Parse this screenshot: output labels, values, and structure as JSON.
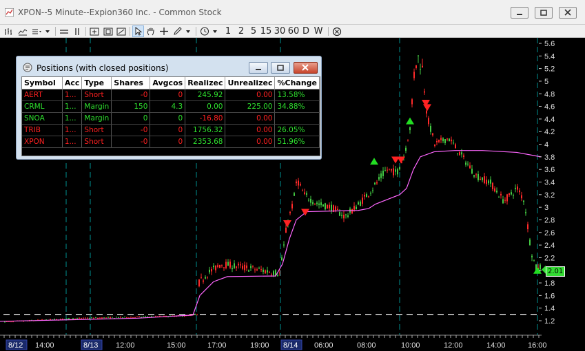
{
  "window": {
    "title": "XPON--5 Minute--Expion360 Inc. - Common Stock"
  },
  "toolbar": {
    "intervals": [
      "1",
      "2",
      "5",
      "15",
      "30",
      "60",
      "D",
      "W"
    ]
  },
  "positions": {
    "title": "Positions (with closed positions)",
    "columns": [
      "Symbol",
      "Acc",
      "Type",
      "Shares",
      "Avgcos",
      "Realizec",
      "Unrealizec",
      "%Change"
    ],
    "rows": [
      {
        "symbol": "AERT",
        "account": "1...",
        "type": "Short",
        "shares": "-0",
        "avgcost": "0",
        "realized": "245.92",
        "unrealized": "0.00",
        "pct": "13.58%",
        "symbol_color": "red",
        "pl_color": "green"
      },
      {
        "symbol": "CRML",
        "account": "1...",
        "type": "Margin",
        "shares": "150",
        "avgcost": "4.3",
        "realized": "0.00",
        "unrealized": "225.00",
        "pct": "34.88%",
        "symbol_color": "green",
        "pl_color": "green"
      },
      {
        "symbol": "SNOA",
        "account": "1...",
        "type": "Margin",
        "shares": "0",
        "avgcost": "0",
        "realized": "-16.80",
        "unrealized": "0.00",
        "pct": "",
        "symbol_color": "green",
        "pl_color": "red"
      },
      {
        "symbol": "TRIB",
        "account": "1...",
        "type": "Short",
        "shares": "-0",
        "avgcost": "0",
        "realized": "1756.32",
        "unrealized": "0.00",
        "pct": "26.05%",
        "symbol_color": "red",
        "pl_color": "green"
      },
      {
        "symbol": "XPON",
        "account": "1...",
        "type": "Short",
        "shares": "-0",
        "avgcost": "0",
        "realized": "2353.68",
        "unrealized": "0.00",
        "pct": "51.96%",
        "symbol_color": "red",
        "pl_color": "green"
      }
    ]
  },
  "chart_data": {
    "type": "candlestick",
    "symbol": "XPON",
    "interval": "5 Minute",
    "y_ticks": [
      "5.6",
      "5.4",
      "5.2",
      "5",
      "4.8",
      "4.6",
      "4.4",
      "4.2",
      "4",
      "3.8",
      "3.6",
      "3.4",
      "3.2",
      "3",
      "2.8",
      "2.6",
      "2.4",
      "2.2",
      "2",
      "1.8",
      "1.6",
      "1.4",
      "1.2"
    ],
    "ylim": [
      1.12,
      5.62
    ],
    "x_labels": [
      "8/12",
      "14:00",
      "8/13",
      "12:00",
      "15:00",
      "17:00",
      "19:00",
      "8/14",
      "06:00",
      "08:00",
      "10:00",
      "12:00",
      "14:00",
      "16:00"
    ],
    "date_labels": [
      "8/12",
      "8/13",
      "8/14"
    ],
    "last_price": "2.01",
    "reference_line": 1.3,
    "price_path": [
      [
        0,
        1.18
      ],
      [
        40,
        1.2
      ],
      [
        80,
        1.22
      ],
      [
        120,
        1.24
      ],
      [
        160,
        1.25
      ],
      [
        200,
        1.26
      ],
      [
        240,
        1.27
      ],
      [
        270,
        1.28
      ],
      [
        285,
        1.3
      ],
      [
        288,
        1.8
      ],
      [
        300,
        1.95
      ],
      [
        320,
        2.1
      ],
      [
        350,
        2.05
      ],
      [
        380,
        2.0
      ],
      [
        405,
        1.95
      ],
      [
        410,
        2.3
      ],
      [
        415,
        2.7
      ],
      [
        425,
        3.1
      ],
      [
        430,
        3.45
      ],
      [
        440,
        3.2
      ],
      [
        460,
        3.05
      ],
      [
        480,
        3.0
      ],
      [
        500,
        2.85
      ],
      [
        520,
        3.05
      ],
      [
        540,
        3.3
      ],
      [
        560,
        3.6
      ],
      [
        575,
        3.55
      ],
      [
        585,
        3.8
      ],
      [
        595,
        4.3
      ],
      [
        600,
        5.1
      ],
      [
        605,
        5.4
      ],
      [
        612,
        5.2
      ],
      [
        620,
        4.4
      ],
      [
        630,
        4.0
      ],
      [
        650,
        4.1
      ],
      [
        670,
        3.8
      ],
      [
        690,
        3.5
      ],
      [
        710,
        3.4
      ],
      [
        730,
        3.1
      ],
      [
        750,
        3.3
      ],
      [
        760,
        3.1
      ],
      [
        765,
        2.7
      ],
      [
        770,
        2.3
      ],
      [
        778,
        2.0
      ],
      [
        782,
        2.05
      ]
    ],
    "vwap_path": [
      [
        0,
        1.19
      ],
      [
        200,
        1.24
      ],
      [
        280,
        1.29
      ],
      [
        290,
        1.6
      ],
      [
        310,
        1.82
      ],
      [
        330,
        1.9
      ],
      [
        400,
        1.91
      ],
      [
        410,
        2.1
      ],
      [
        420,
        2.5
      ],
      [
        430,
        2.8
      ],
      [
        445,
        2.93
      ],
      [
        520,
        2.95
      ],
      [
        535,
        2.98
      ],
      [
        545,
        3.05
      ],
      [
        580,
        3.2
      ],
      [
        590,
        3.3
      ],
      [
        600,
        3.6
      ],
      [
        610,
        3.8
      ],
      [
        630,
        3.88
      ],
      [
        660,
        3.9
      ],
      [
        700,
        3.9
      ],
      [
        750,
        3.87
      ],
      [
        785,
        3.8
      ]
    ],
    "buy_markers": [
      [
        543,
        3.73
      ],
      [
        595,
        4.37
      ],
      [
        780,
        2.0
      ]
    ],
    "sell_markers": [
      [
        417,
        2.74
      ],
      [
        443,
        2.92
      ],
      [
        574,
        3.75
      ],
      [
        582,
        3.75
      ],
      [
        618,
        4.65
      ],
      [
        620,
        4.58
      ]
    ],
    "cyan_dashed_x": [
      96,
      131,
      285,
      407,
      580,
      780
    ],
    "colors": {
      "up": "#44cc44",
      "down": "#ff2a2a",
      "vwap": "#ff66ff",
      "grid_day": "#00cccc",
      "background": "#000000"
    }
  }
}
